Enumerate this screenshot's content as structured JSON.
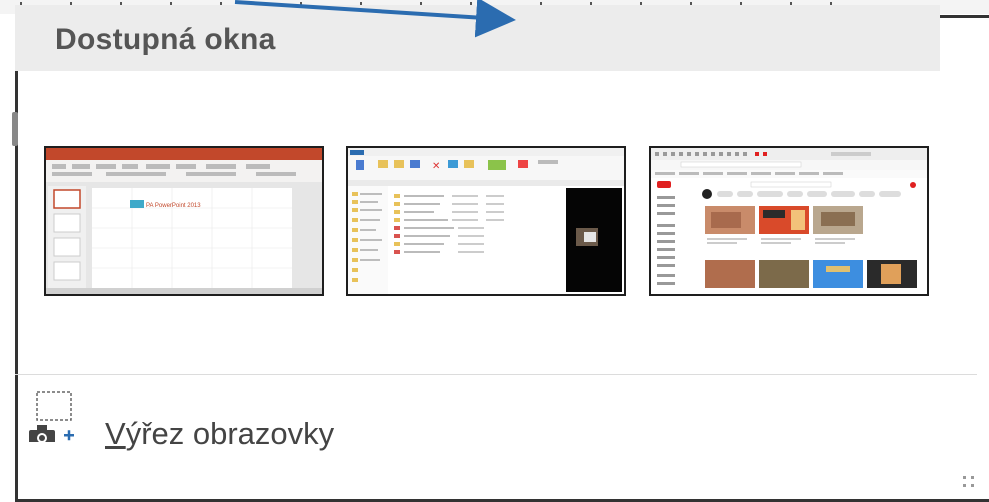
{
  "panel": {
    "header_title": "Dostupná okna",
    "windows": [
      {
        "name": "PowerPoint",
        "slide_title": "PA PowerPoint 2013"
      },
      {
        "name": "File Explorer"
      },
      {
        "name": "YouTube"
      }
    ],
    "screen_clipping": {
      "label_access_key": "V",
      "label_rest": "ýřez obrazovky"
    }
  },
  "colors": {
    "accent_arrow": "#2b6cb0",
    "powerpoint_red": "#c2482b",
    "header_bg": "#ececec",
    "youtube_red": "#e02020"
  }
}
